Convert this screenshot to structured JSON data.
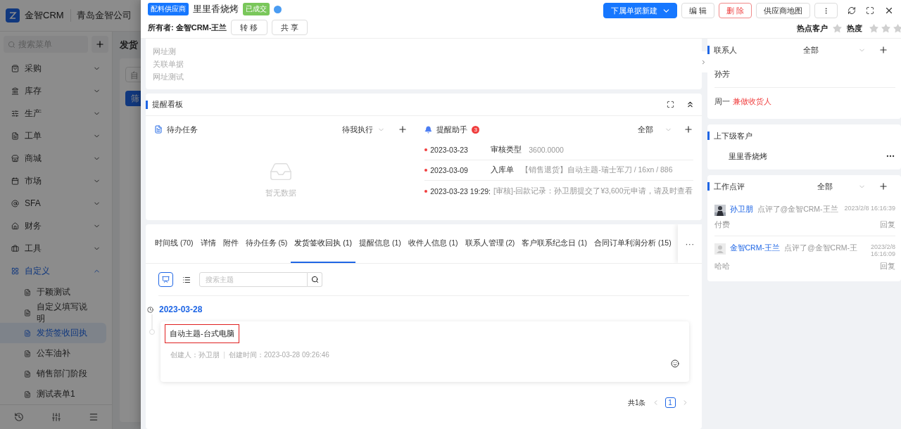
{
  "app": {
    "logo": "金智CRM",
    "company": "青岛金智公司",
    "search_placeholder": "搜索菜单",
    "page_title": "发货",
    "filter_value": "自",
    "filter_button": "筛",
    "menu": [
      {
        "label": "采购",
        "expanded": false
      },
      {
        "label": "库存",
        "expanded": false
      },
      {
        "label": "生产",
        "expanded": false
      },
      {
        "label": "工单",
        "expanded": false
      },
      {
        "label": "商城",
        "expanded": false
      },
      {
        "label": "市场",
        "expanded": false
      },
      {
        "label": "SFA",
        "expanded": false
      },
      {
        "label": "财务",
        "expanded": false
      },
      {
        "label": "工具",
        "expanded": false
      },
      {
        "label": "自定义",
        "expanded": true,
        "children": [
          {
            "label": "于颖测试",
            "selected": false
          },
          {
            "label": "自定义填写说明",
            "selected": false
          },
          {
            "label": "发货签收回执",
            "selected": true
          },
          {
            "label": "公车油补",
            "selected": false
          },
          {
            "label": "销售部门阶段",
            "selected": false
          },
          {
            "label": "测试表单1",
            "selected": false
          }
        ]
      }
    ]
  },
  "drawer": {
    "type_tag": "配料供应商",
    "title": "里里香烧烤",
    "status_tag": "已成交",
    "owner": "所有者: 金智CRM-王兰",
    "owner_buttons": [
      "转 移",
      "共 享"
    ],
    "actions": [
      {
        "label": "下属单据新建",
        "kind": "primary"
      },
      {
        "label": "编 辑",
        "kind": "default"
      },
      {
        "label": "删 除",
        "kind": "danger"
      },
      {
        "label": "供应商地图",
        "kind": "default"
      }
    ],
    "hot": {
      "label": "热点客户",
      "on": false
    },
    "heat": {
      "label": "热度",
      "stars": 0
    },
    "fields": [
      "网址测",
      "关联单据",
      "网址测试"
    ],
    "board": {
      "title": "提醒看板",
      "todo": {
        "title": "待办任务",
        "filter": "待我执行",
        "empty": "暂无数据"
      },
      "assistant": {
        "title": "提醒助手",
        "badge": "3",
        "filter": "全部",
        "items": [
          {
            "date": "2023-03-23",
            "type": "审核类型",
            "detail": "3600.0000"
          },
          {
            "date": "2023-03-09",
            "type": "入库单",
            "detail": "【销售退货】自动主题-瑞士军刀 / 16xn / 886"
          },
          {
            "date": "2023-03-23 19:29:",
            "detail": "[审核]-回款记录：孙卫朋提交了¥3,600元申请，请及时查看"
          }
        ]
      }
    },
    "tabs": [
      {
        "label": "时间线 (70)",
        "selected": false
      },
      {
        "label": "详情",
        "selected": false
      },
      {
        "label": "附件",
        "selected": false
      },
      {
        "label": "待办任务 (5)",
        "selected": false
      },
      {
        "label": "发货签收回执 (1)",
        "selected": true
      },
      {
        "label": "提醒信息 (1)",
        "selected": false
      },
      {
        "label": "收件人信息 (1)",
        "selected": false
      },
      {
        "label": "联系人管理 (2)",
        "selected": false
      },
      {
        "label": "客户联系纪念日 (1)",
        "selected": false
      },
      {
        "label": "合同订单利润分析 (15)",
        "selected": false
      }
    ],
    "tabs_more": "···",
    "timeline": {
      "views": [
        {
          "kind": "card",
          "selected": true
        },
        {
          "kind": "list",
          "selected": false
        }
      ],
      "search_placeholder": "搜索主题",
      "date": "2023-03-28",
      "entries": [
        {
          "title": "自动主题-台式电脑",
          "highlighted": true,
          "creator": "创建人：孙卫朋",
          "created": "创建时间：2023-03-28 09:26:46"
        }
      ],
      "total": "共1条",
      "pages": [
        {
          "label": "1",
          "selected": true
        }
      ]
    },
    "contacts": {
      "title": "联系人",
      "filter": "全部",
      "items": [
        {
          "name": "孙芳"
        },
        {
          "name": "周一",
          "tag": "兼做收货人"
        }
      ]
    },
    "hierarchy": {
      "title": "上下级客户",
      "items": [
        {
          "name": "里里香烧烤"
        }
      ]
    },
    "reviews": {
      "title": "工作点评",
      "filter": "全部",
      "items": [
        {
          "author": "孙卫朋",
          "action": "点评了@金智CRM-王兰",
          "time": "2023/2/8 16:16:39",
          "body": "付费",
          "reply": "回复"
        },
        {
          "kind": "default",
          "author": "金智CRM-王兰",
          "action": "点评了@金智CRM-王",
          "time": "2023/2/8 16:16:09",
          "body": "哈哈",
          "reply": "回复"
        }
      ]
    }
  }
}
